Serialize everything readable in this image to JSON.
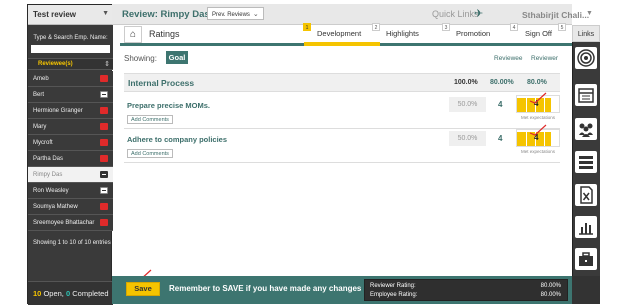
{
  "sidebar": {
    "select_label": "Test review",
    "search_label": "Type & Search Emp. Name:",
    "search_value": "",
    "list_header": "Reviewee(s)",
    "items": [
      {
        "name": "Ameb",
        "badge": "red",
        "active": false
      },
      {
        "name": "Bert",
        "badge": "white",
        "active": false
      },
      {
        "name": "Hermione Granger",
        "badge": "red",
        "active": false
      },
      {
        "name": "Mary",
        "badge": "red",
        "active": false
      },
      {
        "name": "Mycroft",
        "badge": "red",
        "active": false
      },
      {
        "name": "Partha Das",
        "badge": "red",
        "active": false
      },
      {
        "name": "Rimpy Das",
        "badge": "dark",
        "active": true
      },
      {
        "name": "Ron Weasley",
        "badge": "white",
        "active": false
      },
      {
        "name": "Soumya Mathew",
        "badge": "red",
        "active": false
      },
      {
        "name": "Sreemoyee Bhattachar",
        "badge": "red",
        "active": false
      }
    ],
    "showing_text": "Showing 1 to 10 of 10 entries",
    "open_count": "10",
    "open_label": "Open,",
    "completed_count": "0",
    "completed_label": "Completed"
  },
  "topbar": {
    "title": "Review: Rimpy Das",
    "prev_reviews": "Prev. Reviews",
    "quick_links": "Quick Links",
    "user": "Sthabirjit Chali..."
  },
  "tabs": {
    "ratings": "Ratings",
    "items": [
      {
        "num": "1",
        "label": "Development",
        "active": true
      },
      {
        "num": "2",
        "label": "Highlights",
        "active": false
      },
      {
        "num": "3",
        "label": "Promotion",
        "active": false
      },
      {
        "num": "4",
        "label": "Sign Off",
        "active": false
      },
      {
        "num": "5",
        "label": "",
        "active": false
      }
    ]
  },
  "showing": {
    "label": "Showing:",
    "goal_button": "Goal",
    "col_reviewee": "Reviewee",
    "col_reviewer": "Reviewer"
  },
  "section": {
    "title": "Internal Process",
    "pct1": "100.0%",
    "pct2": "80.00%",
    "pct3": "80.0%"
  },
  "goals": [
    {
      "title": "Prepare precise MOMs.",
      "add_comments": "Add Comments",
      "weight": "50.0%",
      "reviewee": "4",
      "reviewer": "4",
      "met": "Met expectations",
      "rating_fraction": 0.8
    },
    {
      "title": "Adhere to company policies",
      "add_comments": "Add Comments",
      "weight": "50.0%",
      "reviewee": "4",
      "reviewer": "4",
      "met": "Met expectations",
      "rating_fraction": 0.8
    }
  ],
  "bottom": {
    "save": "Save",
    "note": "Remember to SAVE if you have made any changes",
    "reviewer_rating_label": "Reviewer Rating:",
    "reviewer_rating_value": "80.00%",
    "employee_rating_label": "Employee Rating:",
    "employee_rating_value": "80.00%"
  },
  "links": {
    "header": "Links",
    "icons": [
      "target-icon",
      "calendar-icon",
      "group-icon",
      "list-icon",
      "excel-icon",
      "bar-chart-icon",
      "briefcase-icon"
    ]
  },
  "colors": {
    "teal": "#3d7570",
    "yellow": "#f5c400",
    "red": "#e02a2a"
  }
}
